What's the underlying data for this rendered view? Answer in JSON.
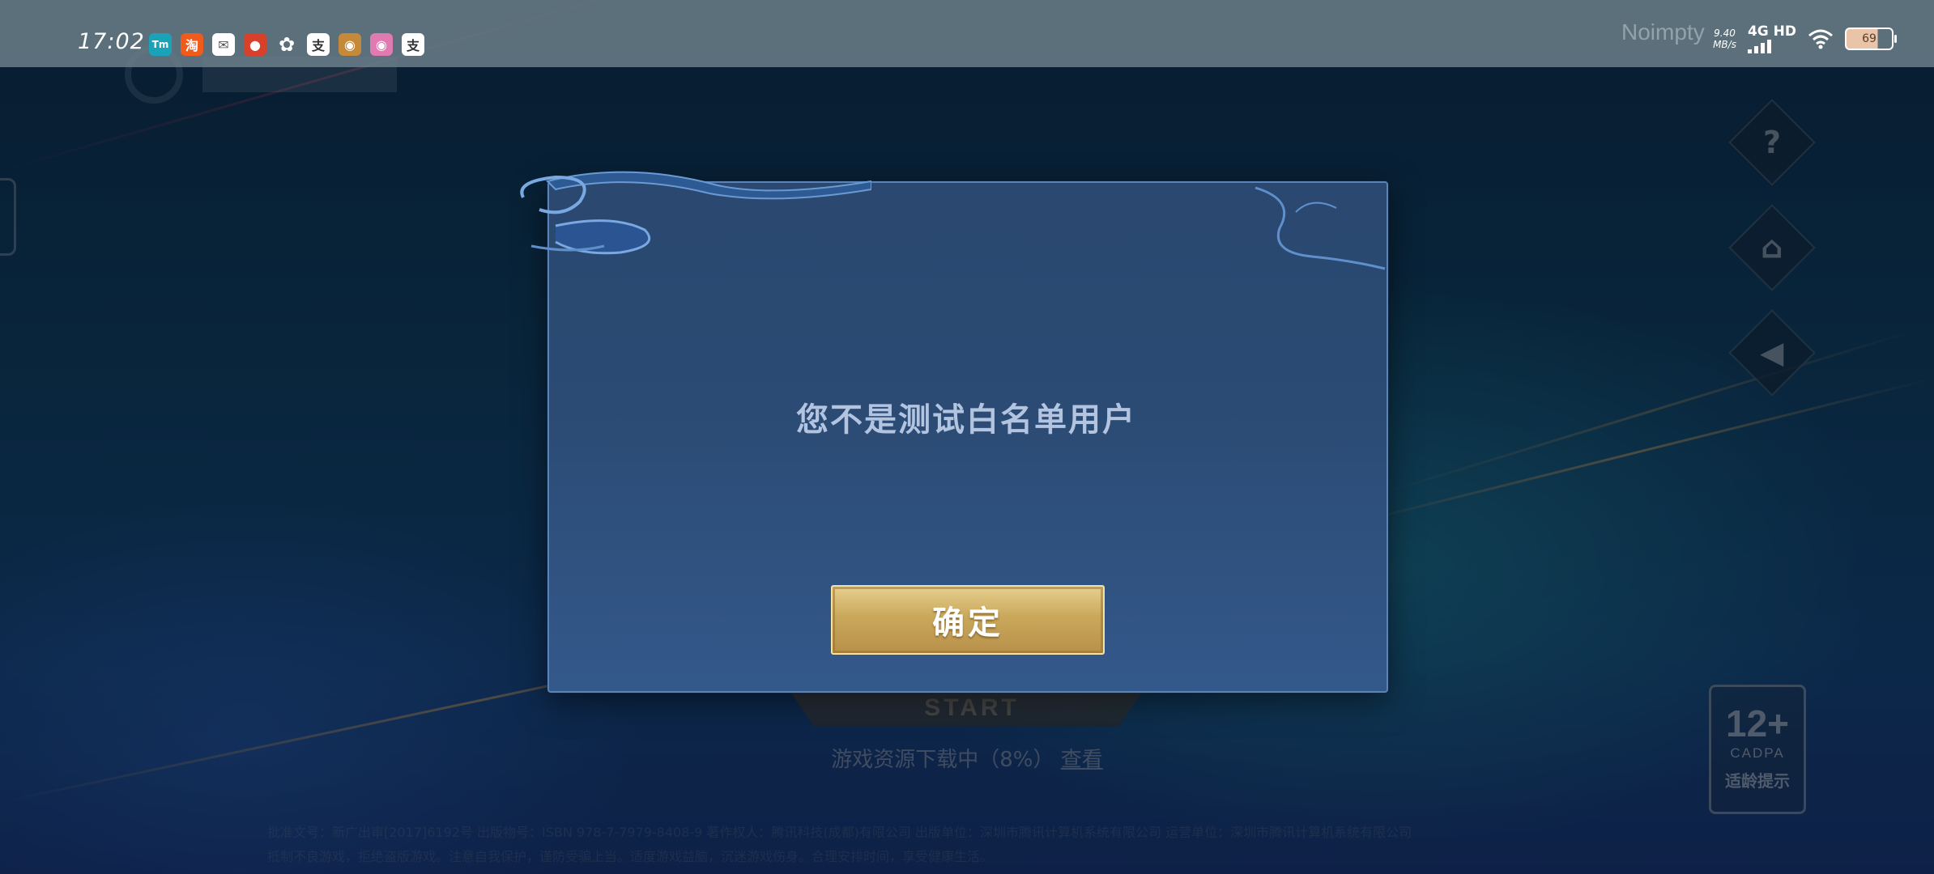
{
  "status_bar": {
    "time": "17:02",
    "notification_icons": [
      {
        "name": "tmall-icon",
        "glyph": "Tm",
        "color": "#1aa3b8"
      },
      {
        "name": "taobao-icon",
        "glyph": "淘",
        "color": "#f05a1a"
      },
      {
        "name": "message-icon",
        "glyph": "✉",
        "color": "#ffffff"
      },
      {
        "name": "game-icon-red",
        "glyph": "●",
        "color": "#d8402a"
      },
      {
        "name": "pinwheel-icon",
        "glyph": "✿",
        "color": "#ffffff"
      },
      {
        "name": "app-icon-1",
        "glyph": "支",
        "color": "#ffffff"
      },
      {
        "name": "avatar-game-icon",
        "glyph": "◉",
        "color": "#c48a3a"
      },
      {
        "name": "avatar-anime-icon",
        "glyph": "◉",
        "color": "#e07ab0"
      },
      {
        "name": "app-icon-2",
        "glyph": "支",
        "color": "#ffffff"
      }
    ],
    "net_speed_value": "9.40",
    "net_speed_unit": "MB/s",
    "network_label": "4G HD",
    "battery": "69",
    "battery_level_percent": 69
  },
  "username": "Noimpty",
  "side_buttons": [
    {
      "name": "help-icon",
      "glyph": "?"
    },
    {
      "name": "gamepad-icon",
      "glyph": "⌂"
    },
    {
      "name": "speaker-icon",
      "glyph": "◀"
    }
  ],
  "age_rating": {
    "age": "12+",
    "org": "CADPA",
    "tip": "适龄提示"
  },
  "start_label": "START",
  "download": {
    "text": "游戏资源下载中（8%）",
    "link": "查看",
    "progress_percent": 8
  },
  "legal_lines": [
    "批准文号：新广出审[2017]6192号 出版物号：ISBN 978-7-7979-8408-9 著作权人：腾讯科技(成都)有限公司 出版单位：深圳市腾讯计算机系统有限公司 运营单位：深圳市腾讯计算机系统有限公司",
    "抵制不良游戏，拒绝盗版游戏。注意自我保护，谨防受骗上当。适度游戏益脑，沉迷游戏伤身。合理安排时间，享受健康生活。"
  ],
  "dialog": {
    "message": "您不是测试白名单用户",
    "confirm_label": "确定"
  }
}
